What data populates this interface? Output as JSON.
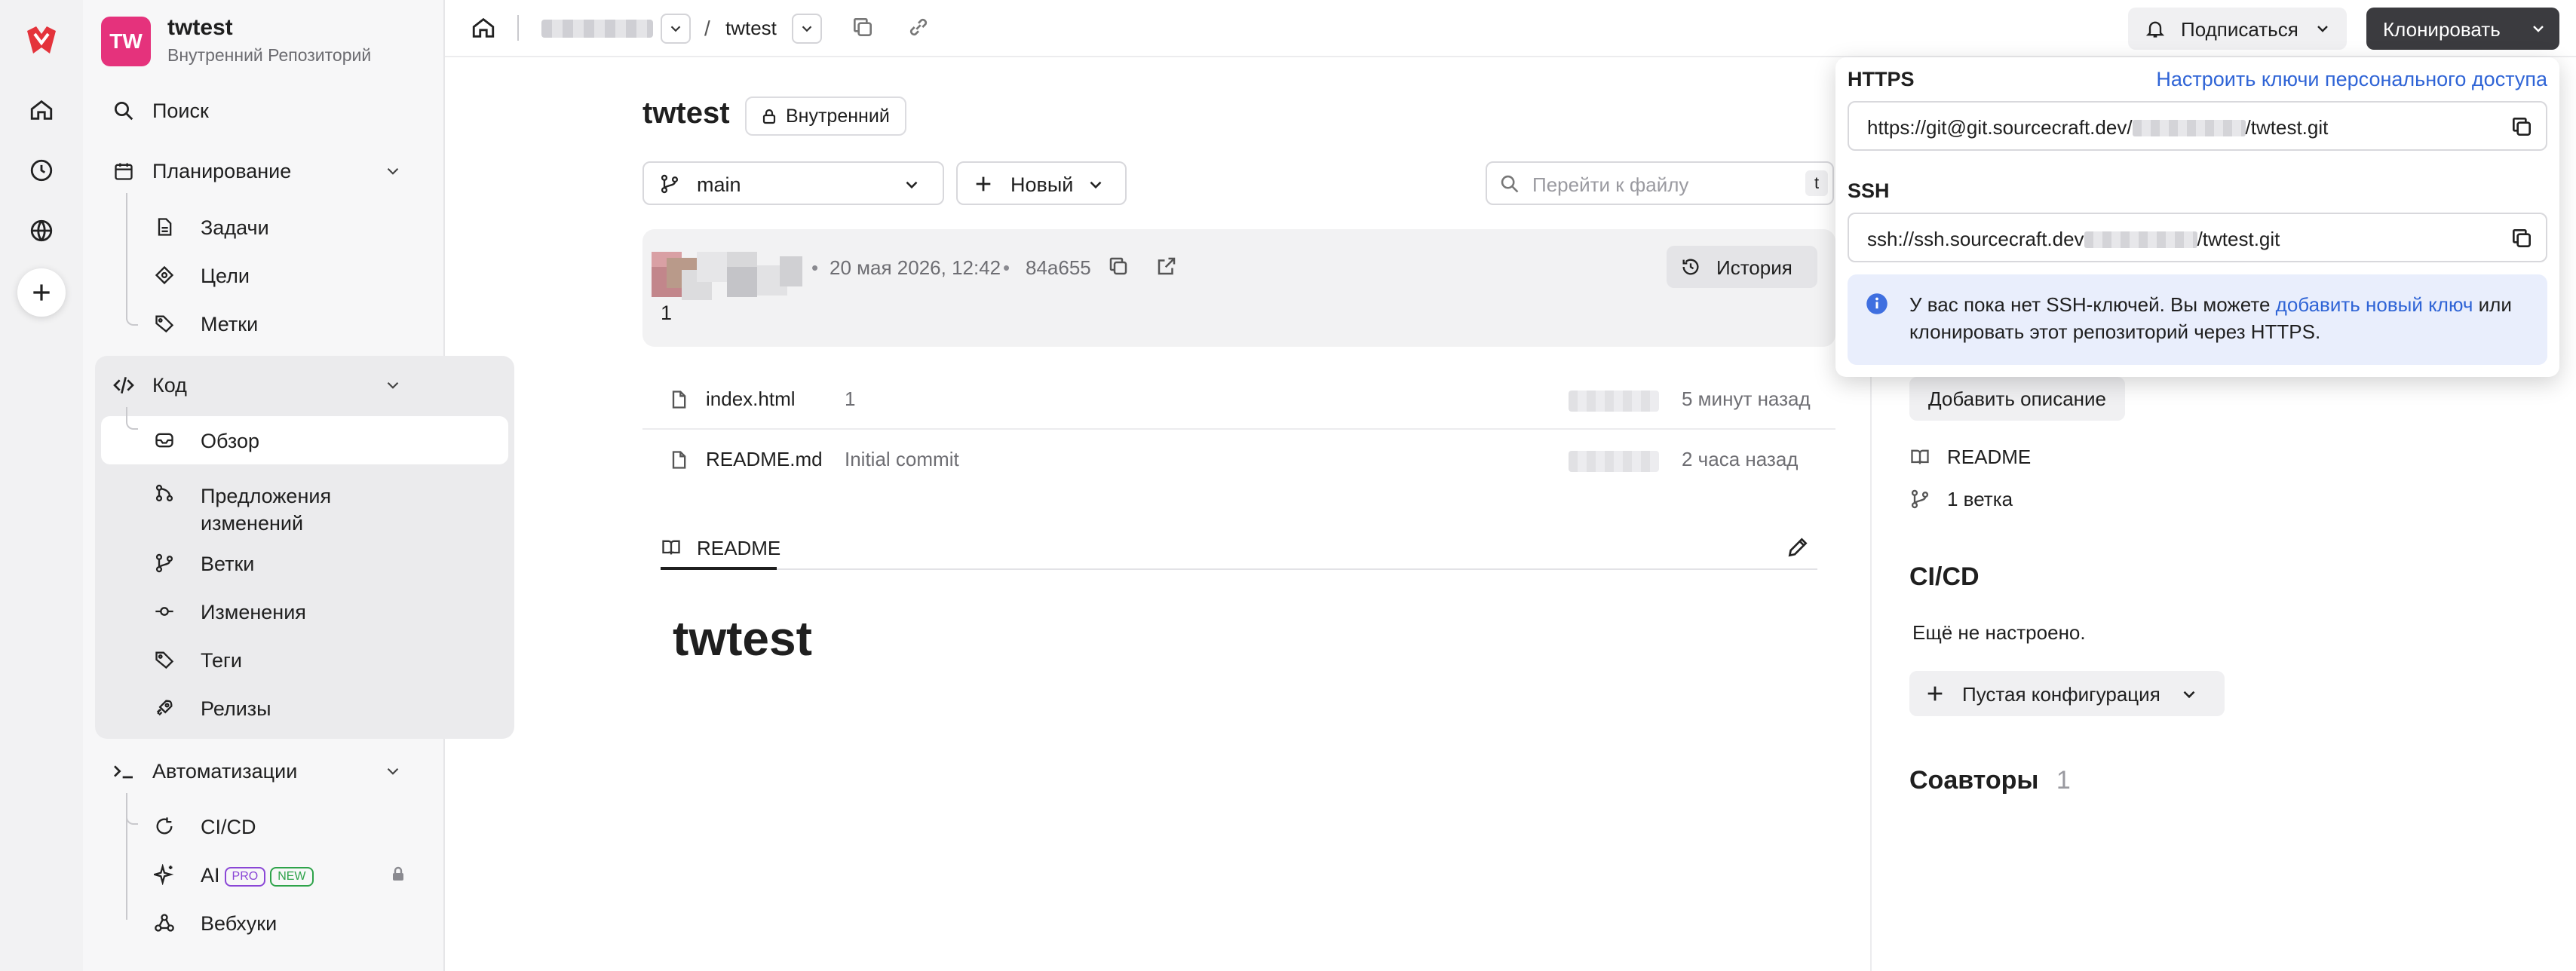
{
  "repo": {
    "avatar": "TW",
    "name": "twtest",
    "subtitle": "Внутренний Репозиторий"
  },
  "sidebar": {
    "search": "Поиск",
    "planning": {
      "label": "Планирование",
      "items": [
        "Задачи",
        "Цели",
        "Метки"
      ]
    },
    "code": {
      "label": "Код",
      "items": [
        "Обзор",
        "Предложения изменений",
        "Ветки",
        "Изменения",
        "Теги",
        "Релизы"
      ]
    },
    "automation": {
      "label": "Автоматизации",
      "items": [
        "CI/CD",
        "AI",
        "Вебхуки"
      ],
      "badges": {
        "pro": "PRO",
        "new": "NEW"
      }
    }
  },
  "topbar": {
    "repo_crumb": "twtest",
    "subscribe": "Подписаться",
    "clone": "Клонировать"
  },
  "main": {
    "title": "twtest",
    "visibility": "Внутренний",
    "branch": "main",
    "new_label": "Новый",
    "file_search": {
      "placeholder": "Перейти к файлу",
      "shortcut": "t"
    },
    "commit": {
      "date": "20 мая 2026, 12:42",
      "hash": "84a655",
      "message": "1",
      "history": "История"
    },
    "files": [
      {
        "name": "index.html",
        "message": "1",
        "time": "5 минут назад"
      },
      {
        "name": "README.md",
        "message": "Initial commit",
        "time": "2 часа назад"
      }
    ],
    "readme_tab": "README",
    "readme_heading": "twtest"
  },
  "right": {
    "add_description": "Добавить описание",
    "readme": "README",
    "branches": "1 ветка",
    "cicd_title": "CI/CD",
    "cicd_status": "Ещё не настроено.",
    "cicd_button": "Пустая конфигурация",
    "contributors_title": "Соавторы",
    "contributors_count": "1"
  },
  "clone_popup": {
    "https_label": "HTTPS",
    "https_link": "Настроить ключи персонального доступа",
    "https_prefix": "https://git@git.sourcecraft.dev/",
    "https_suffix": "/twtest.git",
    "ssh_label": "SSH",
    "ssh_prefix": "ssh://ssh.sourcecraft.dev",
    "ssh_suffix": "/twtest.git",
    "info_before": "У вас пока нет SSH-ключей. Вы можете ",
    "info_link": "добавить новый ключ",
    "info_after": " или клонировать этот репозиторий через HTTPS."
  },
  "colors": {
    "accent": "#2f64d6",
    "repo_avatar": "#e5327c",
    "brand": "#e4333b",
    "clone_button": "#3b3b3f"
  },
  "icons": [
    "brand-logo-icon",
    "home-icon",
    "clock-icon",
    "globe-icon",
    "plus-icon",
    "search-icon",
    "calendar-icon",
    "code-icon",
    "terminal-icon",
    "file-icon",
    "target-icon",
    "tag-icon",
    "inbox-icon",
    "merge-icon",
    "branch-icon",
    "commit-icon",
    "rocket-icon",
    "cicd-icon",
    "sparkle-icon",
    "lock-icon",
    "webhook-icon",
    "copy-icon",
    "link-icon",
    "bell-icon",
    "chevron-down-icon",
    "history-icon",
    "external-link-icon",
    "book-icon",
    "pencil-icon",
    "info-icon"
  ]
}
